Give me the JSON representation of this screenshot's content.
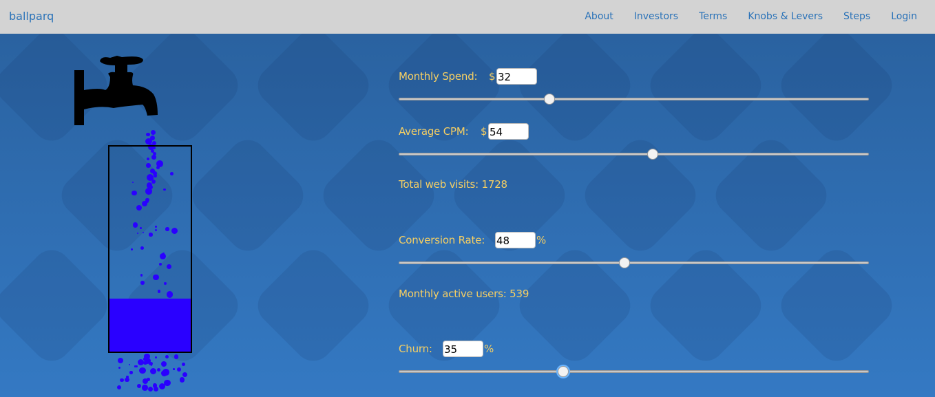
{
  "nav": {
    "brand": "ballparq",
    "links": [
      "About",
      "Investors",
      "Terms",
      "Knobs & Levers",
      "Steps",
      "Login"
    ]
  },
  "colors": {
    "label": "#f6cf63",
    "water": "#2a00ff",
    "background": "#2c67a6",
    "nav_bg": "#d3d3d3",
    "link": "#2a72b8"
  },
  "controls": {
    "spend": {
      "label": "Monthly Spend:",
      "prefix": "$",
      "value": "32",
      "slider": 32,
      "min": 0,
      "max": 100
    },
    "cpm": {
      "label": "Average CPM:",
      "prefix": "$",
      "value": "54",
      "slider": 54,
      "min": 0,
      "max": 100
    },
    "visits": "Total web visits: 1728",
    "conversion": {
      "label": "Conversion Rate:",
      "suffix": "%",
      "value": "48",
      "slider": 48,
      "min": 0,
      "max": 100
    },
    "mau": "Monthly active users: 539",
    "churn": {
      "label": "Churn:",
      "suffix": "%",
      "value": "35",
      "slider": 35,
      "min": 0,
      "max": 100
    }
  },
  "tank": {
    "fill_fraction": 0.26
  },
  "icons": {
    "faucet": "faucet-icon"
  }
}
